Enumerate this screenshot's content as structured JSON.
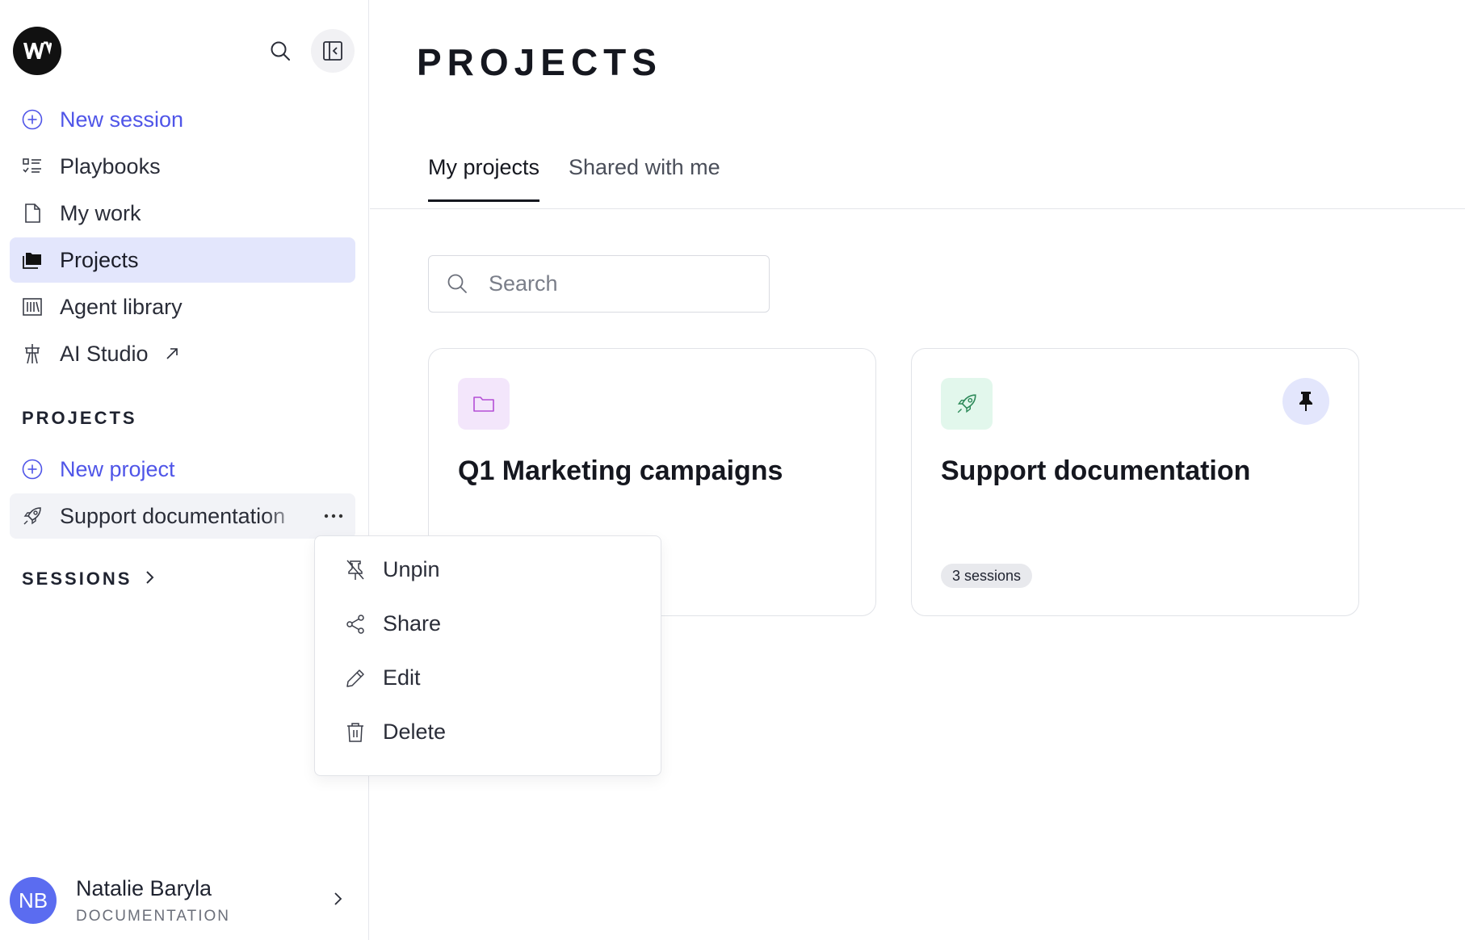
{
  "app": {
    "logo_label": "W"
  },
  "sidebar": {
    "nav": [
      {
        "label": "New session",
        "icon": "plus-circle-icon"
      },
      {
        "label": "Playbooks",
        "icon": "checklist-icon"
      },
      {
        "label": "My work",
        "icon": "document-icon"
      },
      {
        "label": "Projects",
        "icon": "folder-icon"
      },
      {
        "label": "Agent library",
        "icon": "library-icon"
      },
      {
        "label": "AI Studio",
        "icon": "studio-icon"
      }
    ],
    "projects_heading": "PROJECTS",
    "new_project_label": "New project",
    "projects": [
      {
        "label": "Support documentation",
        "icon": "rocket-icon"
      }
    ],
    "sessions_heading": "SESSIONS",
    "user": {
      "initials": "NB",
      "name": "Natalie Baryla",
      "org": "DOCUMENTATION"
    }
  },
  "main": {
    "title": "PROJECTS",
    "tabs": [
      {
        "label": "My projects"
      },
      {
        "label": "Shared with me"
      }
    ],
    "search": {
      "placeholder": "Search"
    },
    "cards": [
      {
        "title": "Q1 Marketing campaigns",
        "icon": "folder-icon"
      },
      {
        "title": "Support documentation",
        "icon": "rocket-icon",
        "badge": "3 sessions",
        "pinned": true
      }
    ]
  },
  "context_menu": {
    "items": [
      {
        "label": "Unpin",
        "icon": "unpin-icon"
      },
      {
        "label": "Share",
        "icon": "share-icon"
      },
      {
        "label": "Edit",
        "icon": "pencil-icon"
      },
      {
        "label": "Delete",
        "icon": "trash-icon"
      }
    ]
  },
  "colors": {
    "accent": "#4f55e8",
    "active_bg": "#e3e6fc",
    "avatar": "#5b6cf0",
    "folder_tile": "#f3e6fb",
    "rocket_tile": "#e2f7ec"
  }
}
